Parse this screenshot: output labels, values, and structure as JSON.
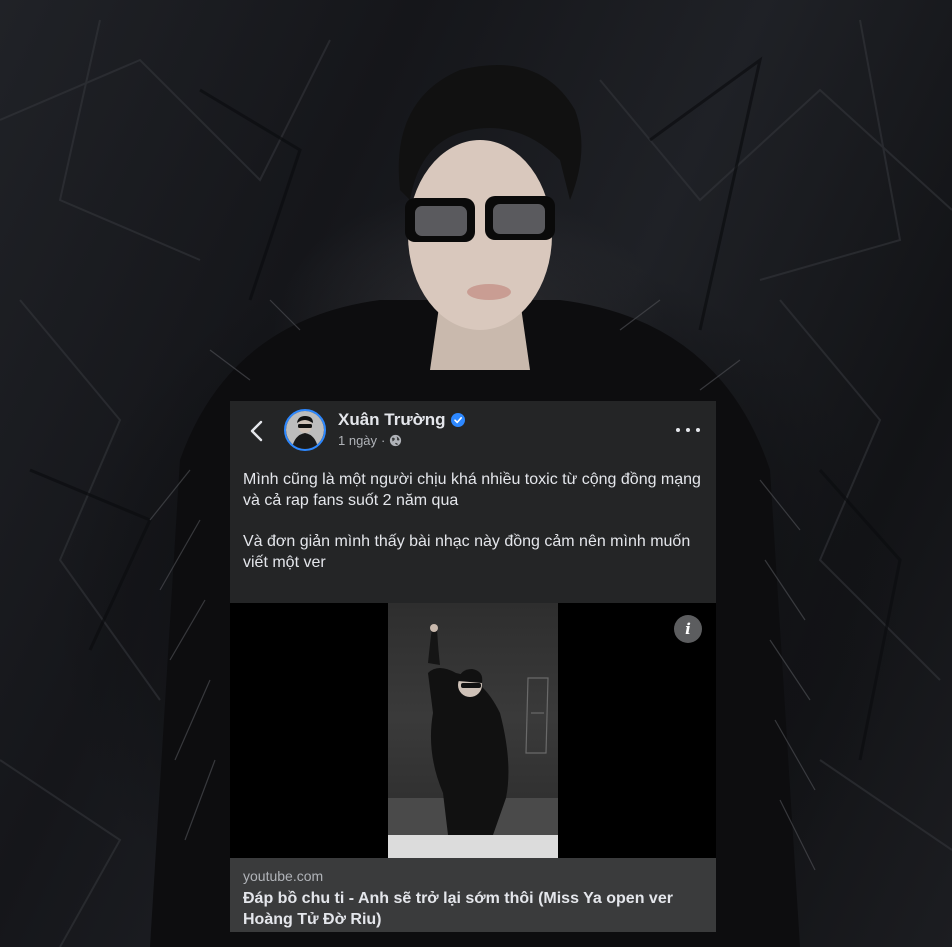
{
  "post": {
    "author_name": "Xuân Trường",
    "verified": true,
    "time": "1 ngày",
    "time_separator": "·",
    "privacy_icon": "globe-icon",
    "paragraphs": [
      "Mình cũng là một người chịu khá nhiều toxic từ cộng đồng mạng và cả rap fans suốt 2 năm qua",
      "Và đơn giản mình thấy bài nhạc này đồng cảm nên mình muốn viết một ver"
    ]
  },
  "link_preview": {
    "domain": "youtube.com",
    "title": "Đáp bồ chu ti - Anh sẽ trở lại sớm thôi (Miss Ya open ver Hoàng Tử Đờ Riu)",
    "info_label": "i"
  },
  "colors": {
    "card_bg": "#242526",
    "caption_bg": "#3a3b3c",
    "accent": "#2d88ff",
    "text_primary": "#e4e6eb",
    "text_secondary": "#b0b3b8"
  }
}
